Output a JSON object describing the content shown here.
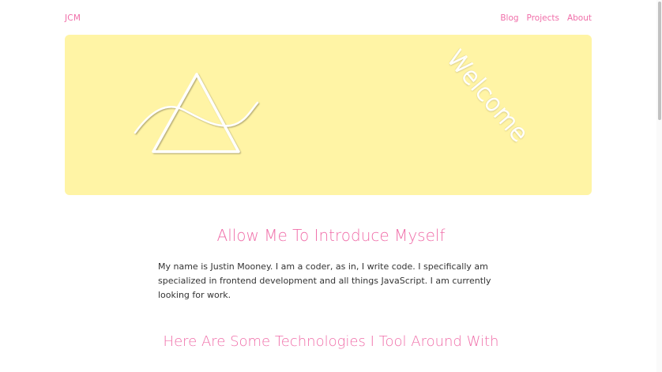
{
  "nav": {
    "brand": "JCM",
    "links": [
      "Blog",
      "Projects",
      "About"
    ]
  },
  "hero": {
    "welcome_text": "Welcome",
    "background_color": "#fff4a5",
    "logo_icon": "triangle-wave-logo-icon"
  },
  "intro": {
    "title": "Allow Me To Introduce Myself",
    "body": "My name is Justin Mooney. I am a coder, as in, I write code. I specifically am specialized in frontend development and all things JavaScript. I am currently looking for work."
  },
  "tech": {
    "title": "Here Are Some Technologies I Tool Around With"
  },
  "colors": {
    "accent": "#f06ea9",
    "text": "#333333",
    "hero_bg": "#fff4a5"
  }
}
